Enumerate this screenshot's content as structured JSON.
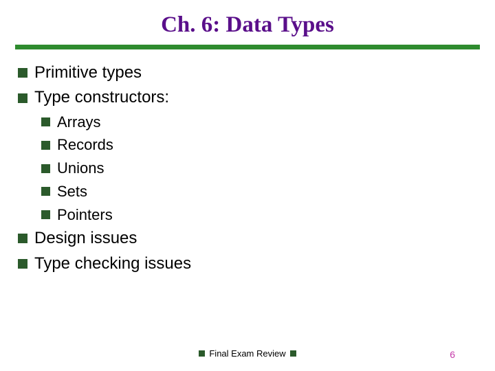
{
  "title": "Ch. 6: Data Types",
  "bullets": [
    {
      "level": 1,
      "text": "Primitive types"
    },
    {
      "level": 1,
      "text": "Type constructors:"
    },
    {
      "level": 2,
      "text": "Arrays"
    },
    {
      "level": 2,
      "text": "Records"
    },
    {
      "level": 2,
      "text": "Unions"
    },
    {
      "level": 2,
      "text": "Sets"
    },
    {
      "level": 2,
      "text": "Pointers"
    },
    {
      "level": 1,
      "text": "Design issues"
    },
    {
      "level": 1,
      "text": "Type checking issues"
    }
  ],
  "footer": "Final Exam Review",
  "page_number": "6",
  "colors": {
    "title": "#5a0f8a",
    "rule": "#2e8b2e",
    "bullet": "#2b5a2b",
    "page_number": "#c43aa8"
  }
}
